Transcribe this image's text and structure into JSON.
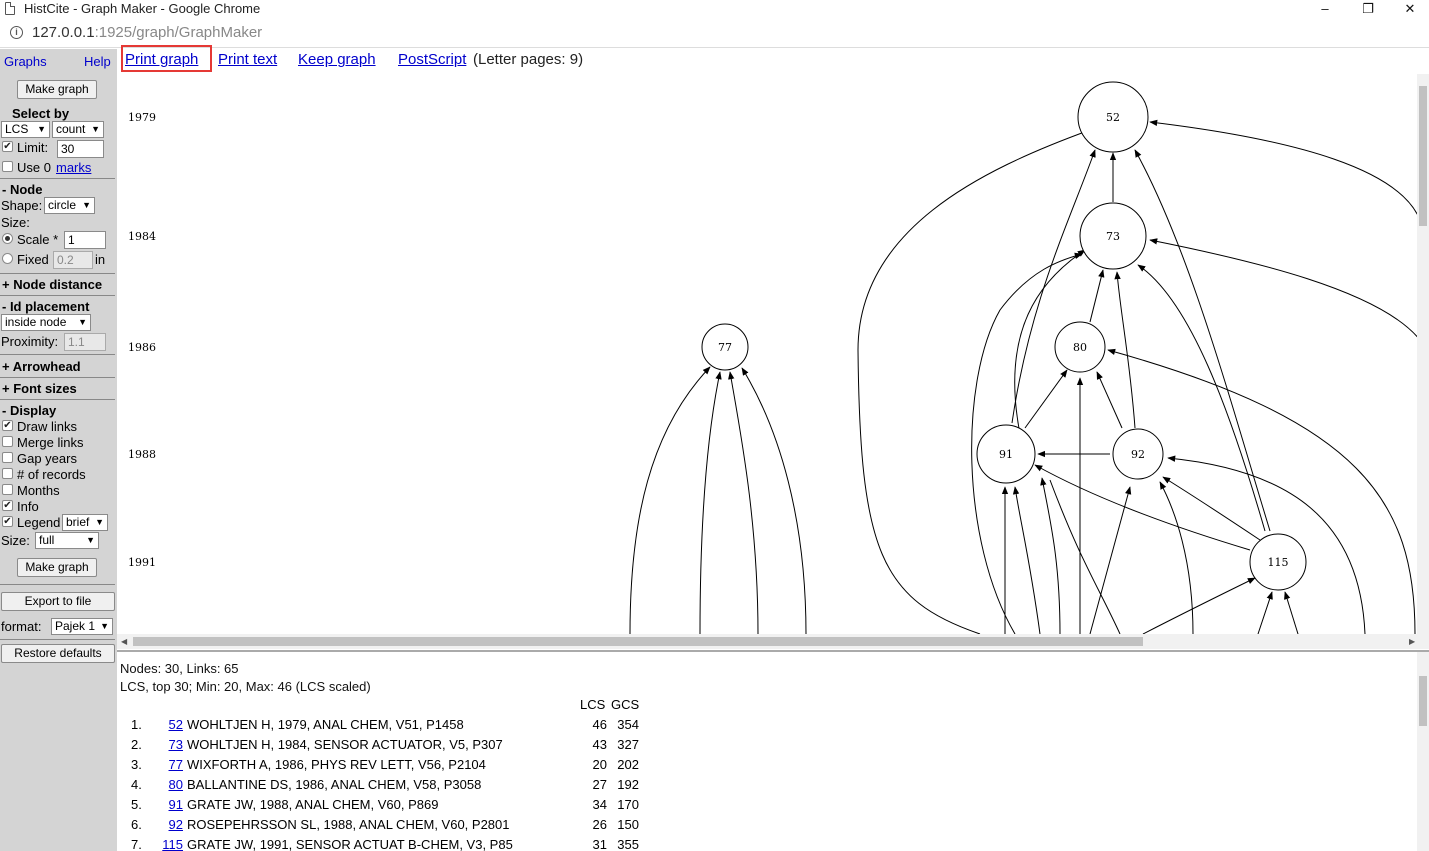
{
  "window": {
    "title": "HistCite - Graph Maker - Google Chrome",
    "minimize": "–",
    "restore": "❐",
    "close": "✕"
  },
  "address": {
    "host": "127.0.0.1",
    "path": ":1925/graph/GraphMaker"
  },
  "sidebar": {
    "graphs_link": "Graphs",
    "help_link": "Help",
    "make_graph": "Make graph",
    "select_by": "Select by",
    "select_field": "LCS",
    "select_mode": "count",
    "limit_label": "Limit:",
    "limit_value": "30",
    "use_label": "Use 0",
    "marks_link": "marks",
    "node_head": "- Node",
    "shape_label": "Shape:",
    "shape_value": "circle",
    "size_label": "Size:",
    "scale_label": "Scale *",
    "scale_value": "1",
    "fixed_label": "Fixed",
    "fixed_value": "0.2",
    "fixed_unit": "in",
    "node_distance": "+ Node distance",
    "id_placement": "- Id placement",
    "id_placement_value": "inside node",
    "proximity_label": "Proximity:",
    "proximity_value": "1.1",
    "arrowhead": "+ Arrowhead",
    "font_sizes": "+ Font sizes",
    "display_head": "- Display",
    "draw_links": "Draw links",
    "merge_links": "Merge links",
    "gap_years": "Gap years",
    "num_records": "# of records",
    "months": "Months",
    "info": "Info",
    "legend": "Legend",
    "legend_value": "brief",
    "size2_label": "Size:",
    "size2_value": "full",
    "make_graph2": "Make graph",
    "export": "Export to file",
    "format_label": "format:",
    "format_value": "Pajek 1",
    "restore": "Restore defaults",
    "checks": {
      "limit": true,
      "use_marks": false,
      "draw_links": true,
      "merge_links": false,
      "gap_years": false,
      "num_records": false,
      "months": false,
      "info": true,
      "legend": true
    }
  },
  "toplinks": {
    "print_graph": "Print graph",
    "print_text": "Print text",
    "keep_graph": "Keep graph",
    "postscript": "PostScript",
    "pages": "(Letter pages: 9)"
  },
  "graph": {
    "years": [
      "1979",
      "1984",
      "1986",
      "1988",
      "1991"
    ],
    "nodes": [
      "52",
      "73",
      "77",
      "80",
      "91",
      "92",
      "115"
    ]
  },
  "textpane": {
    "summary1": "Nodes: 30, Links: 65",
    "summary2": "LCS, top 30; Min: 20, Max: 46 (LCS scaled)",
    "col_lcs": "LCS",
    "col_gcs": "GCS",
    "records": [
      {
        "num": "1.",
        "id": "52",
        "cite": "WOHLTJEN H, 1979, ANAL CHEM, V51, P1458",
        "lcs": "46",
        "gcs": "354"
      },
      {
        "num": "2.",
        "id": "73",
        "cite": "WOHLTJEN H, 1984, SENSOR ACTUATOR, V5, P307",
        "lcs": "43",
        "gcs": "327"
      },
      {
        "num": "3.",
        "id": "77",
        "cite": "WIXFORTH A, 1986, PHYS REV LETT, V56, P2104",
        "lcs": "20",
        "gcs": "202"
      },
      {
        "num": "4.",
        "id": "80",
        "cite": "BALLANTINE DS, 1986, ANAL CHEM, V58, P3058",
        "lcs": "27",
        "gcs": "192"
      },
      {
        "num": "5.",
        "id": "91",
        "cite": "GRATE JW, 1988, ANAL CHEM, V60, P869",
        "lcs": "34",
        "gcs": "170"
      },
      {
        "num": "6.",
        "id": "92",
        "cite": "ROSEPEHRSSON SL, 1988, ANAL CHEM, V60, P2801",
        "lcs": "26",
        "gcs": "150"
      },
      {
        "num": "7.",
        "id": "115",
        "cite": "GRATE JW, 1991, SENSOR ACTUAT B-CHEM, V3, P85",
        "lcs": "31",
        "gcs": "355"
      }
    ]
  }
}
